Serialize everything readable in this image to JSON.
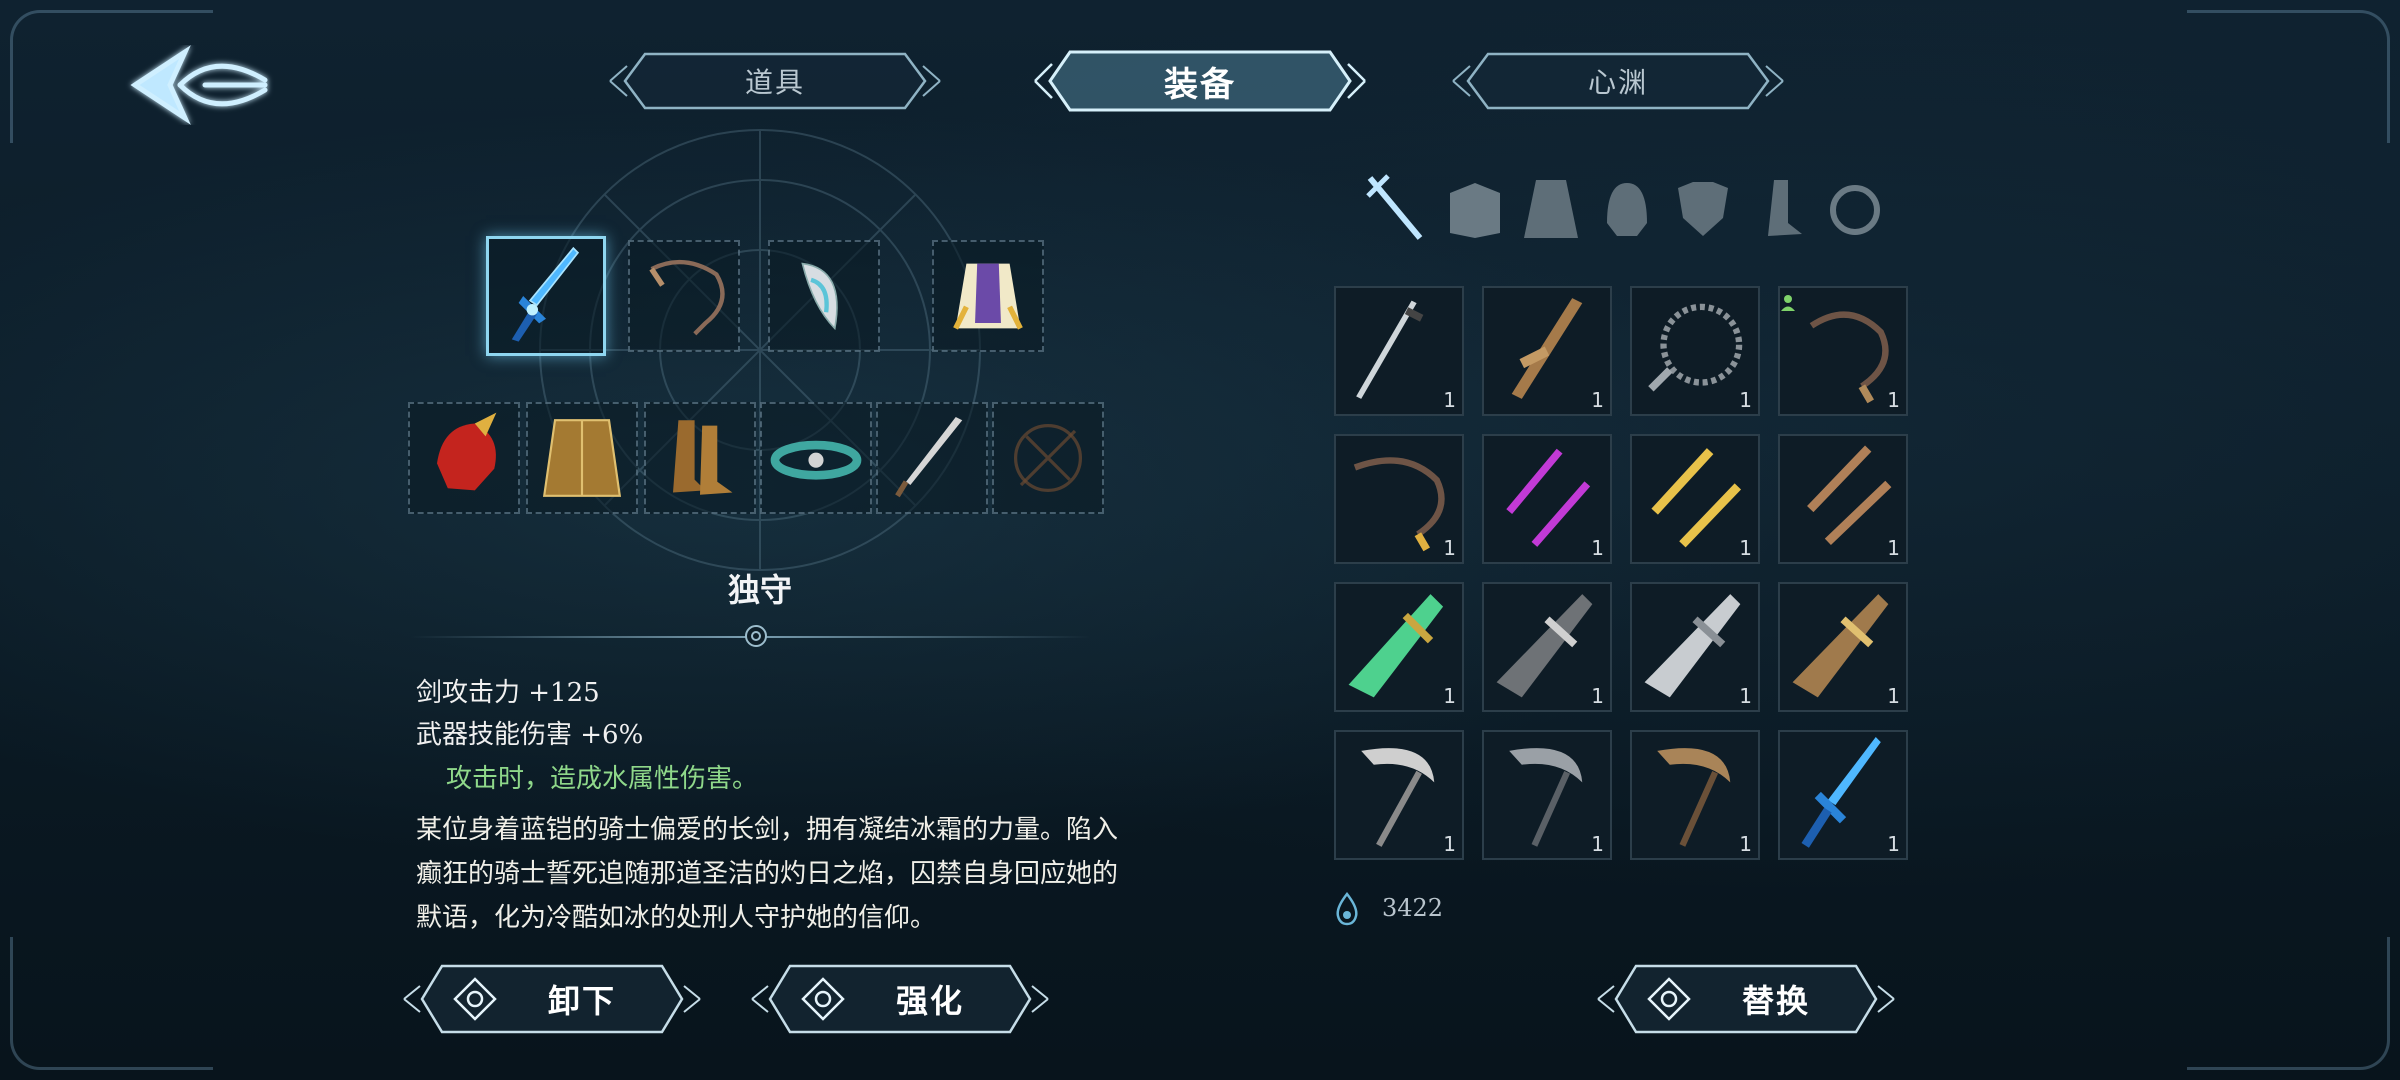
{
  "tabs": [
    {
      "label": "道具",
      "active": false
    },
    {
      "label": "装备",
      "active": true
    },
    {
      "label": "心渊",
      "active": false
    }
  ],
  "categories": [
    "sword-icon",
    "book-icon",
    "cloak-icon",
    "helmet-icon",
    "armor-icon",
    "boots-icon",
    "ring-icon"
  ],
  "equipped": {
    "row1": [
      "ice-sword-icon",
      "whip-icon",
      "blade-fan-icon",
      "robe-icon"
    ],
    "row2": [
      "red-helm-icon",
      "gold-coat-icon",
      "boots-icon",
      "bracelet-icon",
      "dagger-icon",
      "empty-slot-icon"
    ]
  },
  "item": {
    "name": "独守",
    "stat1": "剑攻击力 +125",
    "stat2": "武器技能伤害 +6%",
    "effect": "攻击时，造成水属性伤害。",
    "desc_line1": "某位身着蓝铠的骑士偏爱的长剑，拥有凝结冰霜的力量。陷入",
    "desc_line2": "癫狂的骑士誓死追随那道圣洁的灼日之焰，囚禁自身回应她的",
    "desc_line3": "默语，化为冷酷如冰的处刑人守护她的信仰。"
  },
  "buttons": {
    "unequip": "卸下",
    "enhance": "强化",
    "replace": "替换"
  },
  "inventory": [
    {
      "icon": "katana-icon",
      "qty": "1"
    },
    {
      "icon": "wooden-sword-icon",
      "qty": "1"
    },
    {
      "icon": "thorn-whip-icon",
      "qty": "1"
    },
    {
      "icon": "rope-whip-icon",
      "qty": "1"
    },
    {
      "icon": "rope-whip-icon",
      "qty": "1"
    },
    {
      "icon": "purple-daggers-icon",
      "qty": "1"
    },
    {
      "icon": "golden-daggers-icon",
      "qty": "1"
    },
    {
      "icon": "bronze-daggers-icon",
      "qty": "1"
    },
    {
      "icon": "jade-greatsword-icon",
      "qty": "1"
    },
    {
      "icon": "dark-greatsword-icon",
      "qty": "1"
    },
    {
      "icon": "silver-greatsword-icon",
      "qty": "1"
    },
    {
      "icon": "gold-greatsword-icon",
      "qty": "1"
    },
    {
      "icon": "silver-scythe-icon",
      "qty": "1"
    },
    {
      "icon": "iron-scythe-icon",
      "qty": "1"
    },
    {
      "icon": "bronze-scythe-icon",
      "qty": "1"
    },
    {
      "icon": "ice-sword-icon",
      "qty": "1"
    }
  ],
  "currency": {
    "icon": "water-drop-icon",
    "value": "3422"
  },
  "colors": {
    "accent": "#8fd6f0",
    "effect": "#8fd88a",
    "frame": "#9bbccc"
  }
}
